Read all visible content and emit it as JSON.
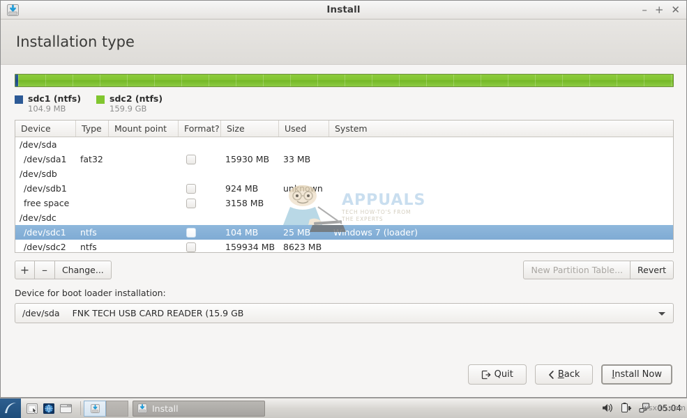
{
  "window": {
    "title": "Install",
    "icon": "install-disk-icon",
    "controls": {
      "minimize": "–",
      "maximize": "+",
      "close": "✕"
    }
  },
  "header": {
    "page_title": "Installation type"
  },
  "partition_bar": {
    "segments": [
      {
        "name": "sdc1",
        "fs": "ntfs",
        "size": "104.9 MB",
        "color": "#2d5a96",
        "fraction": 0.0006
      },
      {
        "name": "sdc2",
        "fs": "ntfs",
        "size": "159.9 GB",
        "color": "#81c62f",
        "fraction": 0.9994
      }
    ],
    "legend": [
      {
        "label": "sdc1 (ntfs)",
        "size": "104.9 MB",
        "color": "#2d5a96"
      },
      {
        "label": "sdc2 (ntfs)",
        "size": "159.9 GB",
        "color": "#81c62f"
      }
    ]
  },
  "table": {
    "columns": [
      "Device",
      "Type",
      "Mount point",
      "Format?",
      "Size",
      "Used",
      "System"
    ],
    "rows": [
      {
        "device": "/dev/sda",
        "type": "",
        "mount": "",
        "format": false,
        "has_checkbox": false,
        "size": "",
        "used": "",
        "system": "",
        "is_disk": true,
        "selected": false
      },
      {
        "device": "/dev/sda1",
        "type": "fat32",
        "mount": "",
        "format": false,
        "has_checkbox": true,
        "size": "15930 MB",
        "used": "33 MB",
        "system": "",
        "is_disk": false,
        "selected": false
      },
      {
        "device": "/dev/sdb",
        "type": "",
        "mount": "",
        "format": false,
        "has_checkbox": false,
        "size": "",
        "used": "",
        "system": "",
        "is_disk": true,
        "selected": false
      },
      {
        "device": "/dev/sdb1",
        "type": "",
        "mount": "",
        "format": false,
        "has_checkbox": true,
        "size": "924 MB",
        "used": "unknown",
        "system": "",
        "is_disk": false,
        "selected": false
      },
      {
        "device": "free space",
        "type": "",
        "mount": "",
        "format": false,
        "has_checkbox": true,
        "size": "3158 MB",
        "used": "",
        "system": "",
        "is_disk": false,
        "selected": false
      },
      {
        "device": "/dev/sdc",
        "type": "",
        "mount": "",
        "format": false,
        "has_checkbox": false,
        "size": "",
        "used": "",
        "system": "",
        "is_disk": true,
        "selected": false
      },
      {
        "device": "/dev/sdc1",
        "type": "ntfs",
        "mount": "",
        "format": false,
        "has_checkbox": true,
        "size": "104 MB",
        "used": "25 MB",
        "system": "Windows 7 (loader)",
        "is_disk": false,
        "selected": true
      },
      {
        "device": "/dev/sdc2",
        "type": "ntfs",
        "mount": "",
        "format": false,
        "has_checkbox": true,
        "size": "159934 MB",
        "used": "8623 MB",
        "system": "",
        "is_disk": false,
        "selected": false
      }
    ]
  },
  "watermark": {
    "brand": "APPUALS",
    "tagline_line1": "TECH HOW-TO'S FROM",
    "tagline_line2": "THE EXPERTS"
  },
  "partition_actions": {
    "add": "+",
    "remove": "–",
    "change": "Change...",
    "new_partition_table": "New Partition Table...",
    "new_partition_table_enabled": false,
    "revert": "Revert"
  },
  "bootloader": {
    "label": "Device for boot loader installation:",
    "selected_device": "/dev/sda",
    "selected_description": "FNK TECH USB CARD READER (15.9 GB"
  },
  "actions": {
    "quit": "Quit",
    "back": "Back",
    "back_mnemonic": "B",
    "back_prefix": "",
    "install": "Install Now",
    "install_mnemonic": "I"
  },
  "taskbar": {
    "launchers": [
      "files-icon",
      "globe-icon",
      "terminal-icon"
    ],
    "workspaces": [
      {
        "name": "workspace-1",
        "active": true,
        "icon": "install-disk-icon"
      },
      {
        "name": "workspace-2",
        "active": false,
        "icon": ""
      }
    ],
    "tasks": [
      {
        "label": "Install",
        "icon": "install-disk-icon",
        "active": true
      }
    ],
    "tray": [
      "volume-icon",
      "battery-icon",
      "network-icon"
    ],
    "clock": "05:04",
    "watermark": "wsxdn.com"
  }
}
